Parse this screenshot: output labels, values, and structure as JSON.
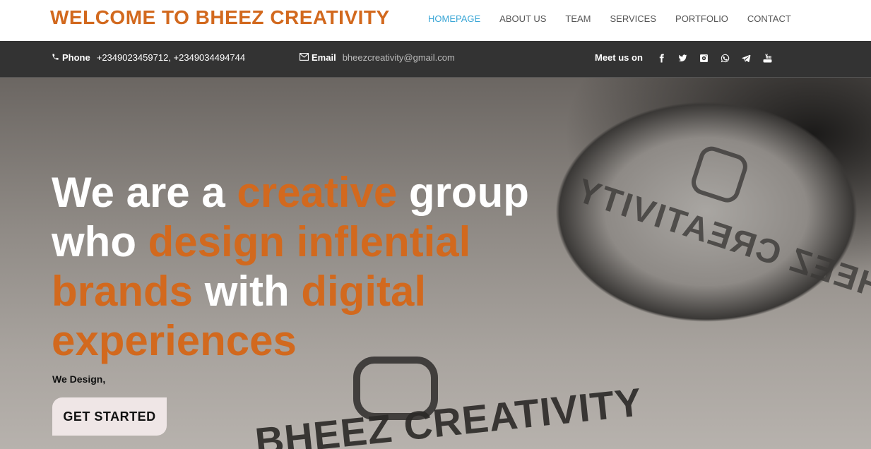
{
  "header": {
    "brand": "WELCOME TO BHEEZ CREATIVITY",
    "nav": [
      {
        "label": "HOMEPAGE",
        "active": true
      },
      {
        "label": "ABOUT US",
        "active": false
      },
      {
        "label": "TEAM",
        "active": false
      },
      {
        "label": "SERVICES",
        "active": false
      },
      {
        "label": "PORTFOLIO",
        "active": false
      },
      {
        "label": "CONTACT",
        "active": false
      }
    ]
  },
  "infobar": {
    "phone_label": "Phone",
    "phone_value": "+2349023459712, +2349034494744",
    "email_label": "Email",
    "email_value": "bheezcreativity@gmail.com",
    "meet_label": "Meet us on",
    "socials": [
      "facebook-icon",
      "twitter-icon",
      "instagram-icon",
      "whatsapp-icon",
      "telegram-icon",
      "youtube-icon"
    ]
  },
  "hero": {
    "headline": [
      {
        "text": "We are a ",
        "highlight": false
      },
      {
        "text": "creative",
        "highlight": true
      },
      {
        "text": " group who ",
        "highlight": false
      },
      {
        "text": "design inflential brands",
        "highlight": true
      },
      {
        "text": " with ",
        "highlight": false
      },
      {
        "text": "digital experiences",
        "highlight": true
      }
    ],
    "subtitle": "We Design,",
    "cta_label": "GET STARTED",
    "background_brand_text": "BHEEZ CREATIVITY"
  },
  "colors": {
    "accent": "#d2691e",
    "nav_active": "#3aa6d6",
    "infobar_bg": "#333333"
  }
}
